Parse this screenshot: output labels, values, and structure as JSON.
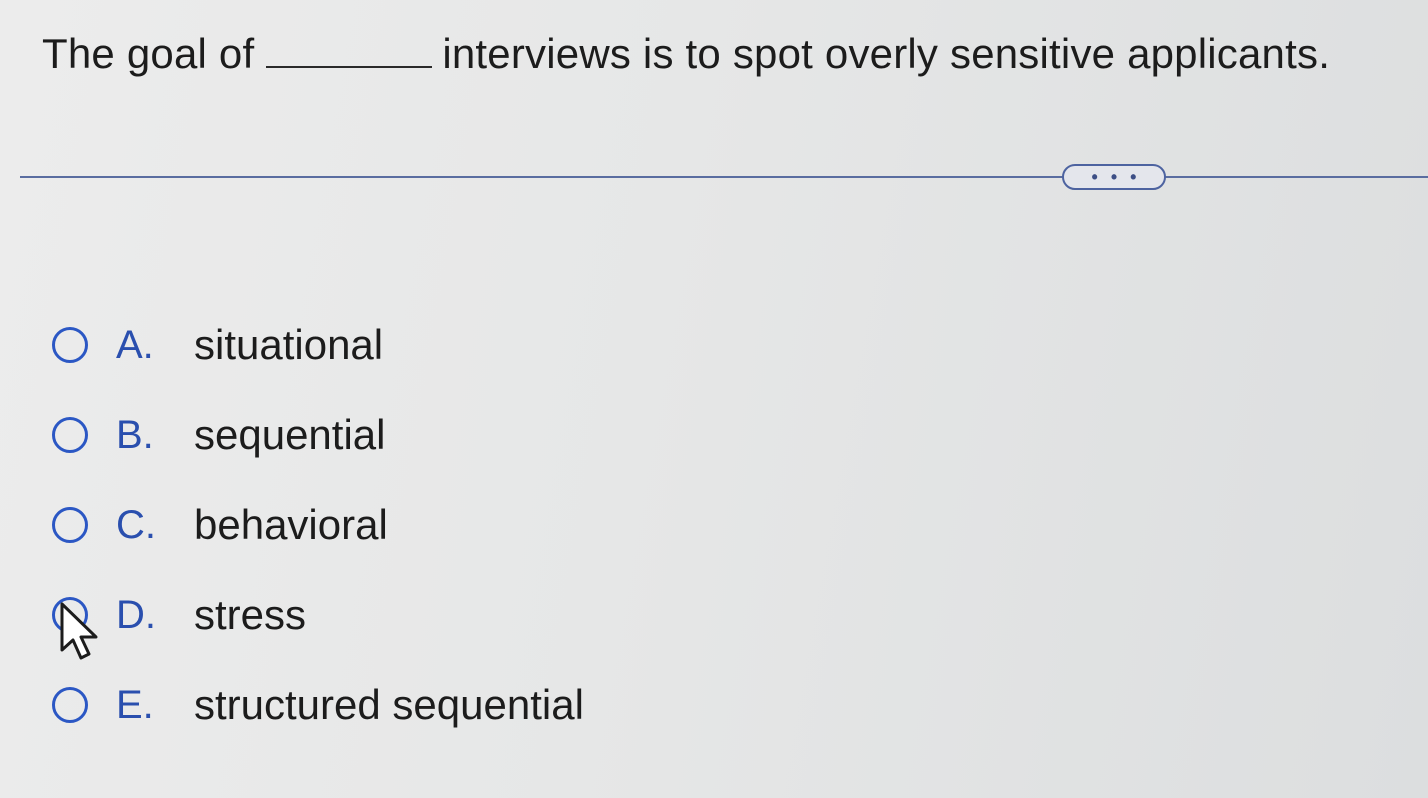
{
  "question": {
    "text_before": "The goal of",
    "text_after": "interviews is to spot overly sensitive applicants."
  },
  "more_button": {
    "label": "• • •"
  },
  "options": [
    {
      "letter": "A.",
      "text": "situational"
    },
    {
      "letter": "B.",
      "text": "sequential"
    },
    {
      "letter": "C.",
      "text": "behavioral"
    },
    {
      "letter": "D.",
      "text": "stress"
    },
    {
      "letter": "E.",
      "text": "structured sequential"
    }
  ],
  "colors": {
    "accent": "#2b57c4",
    "divider": "#5a6da0",
    "text": "#1c1c1c"
  },
  "icons": {
    "cursor": "mouse-pointer-icon"
  }
}
